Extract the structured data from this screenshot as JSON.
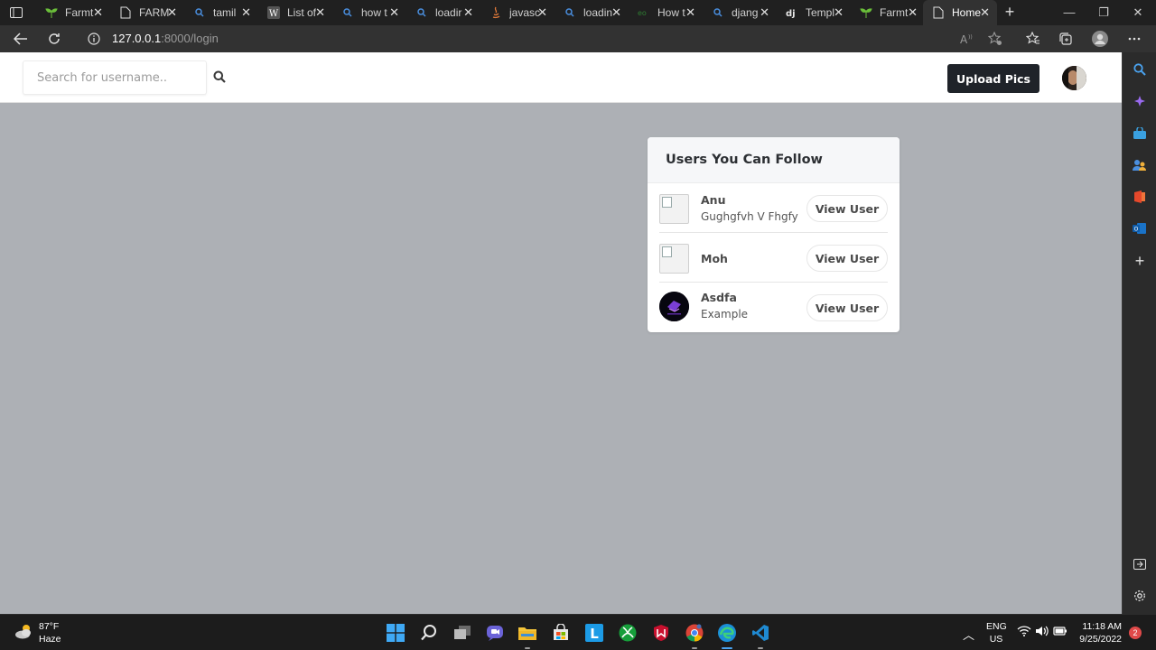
{
  "browser": {
    "tabs": [
      {
        "title": "Farmt",
        "icon": "sprout-icon"
      },
      {
        "title": "FARM",
        "icon": "page-icon"
      },
      {
        "title": "tamil",
        "icon": "search-icon"
      },
      {
        "title": "List of",
        "icon": "wikipedia-icon"
      },
      {
        "title": "how t",
        "icon": "search-icon"
      },
      {
        "title": "loadir",
        "icon": "search-icon"
      },
      {
        "title": "javasc",
        "icon": "java-icon"
      },
      {
        "title": "loadin",
        "icon": "search-icon"
      },
      {
        "title": "How t",
        "icon": "site-icon"
      },
      {
        "title": "djang",
        "icon": "search-icon"
      },
      {
        "title": "Templ",
        "icon": "django-icon"
      },
      {
        "title": "Farmt",
        "icon": "sprout-icon"
      },
      {
        "title": "Home",
        "icon": "page-icon",
        "active": true
      }
    ],
    "address": {
      "host": "127.0.0.1",
      "rest": ":8000/login"
    }
  },
  "page": {
    "search": {
      "placeholder": "Search for username.."
    },
    "upload_label": "Upload Pics",
    "card": {
      "title": "Users You Can Follow",
      "users": [
        {
          "name": "Anu",
          "subtitle": "Gughgfvh V Fhgfy",
          "button": "View User"
        },
        {
          "name": "Moh",
          "subtitle": "",
          "button": "View User"
        },
        {
          "name": "Asdfa",
          "subtitle": "Example",
          "button": "View User"
        }
      ]
    }
  },
  "taskbar": {
    "weather": {
      "temp": "87°F",
      "desc": "Haze"
    },
    "lang": "ENG",
    "region": "US",
    "time": "11:18 AM",
    "date": "9/25/2022",
    "notifications": "2"
  },
  "colors": {
    "page_bg": "#adb0b5",
    "upload_btn": "#1f2329"
  }
}
